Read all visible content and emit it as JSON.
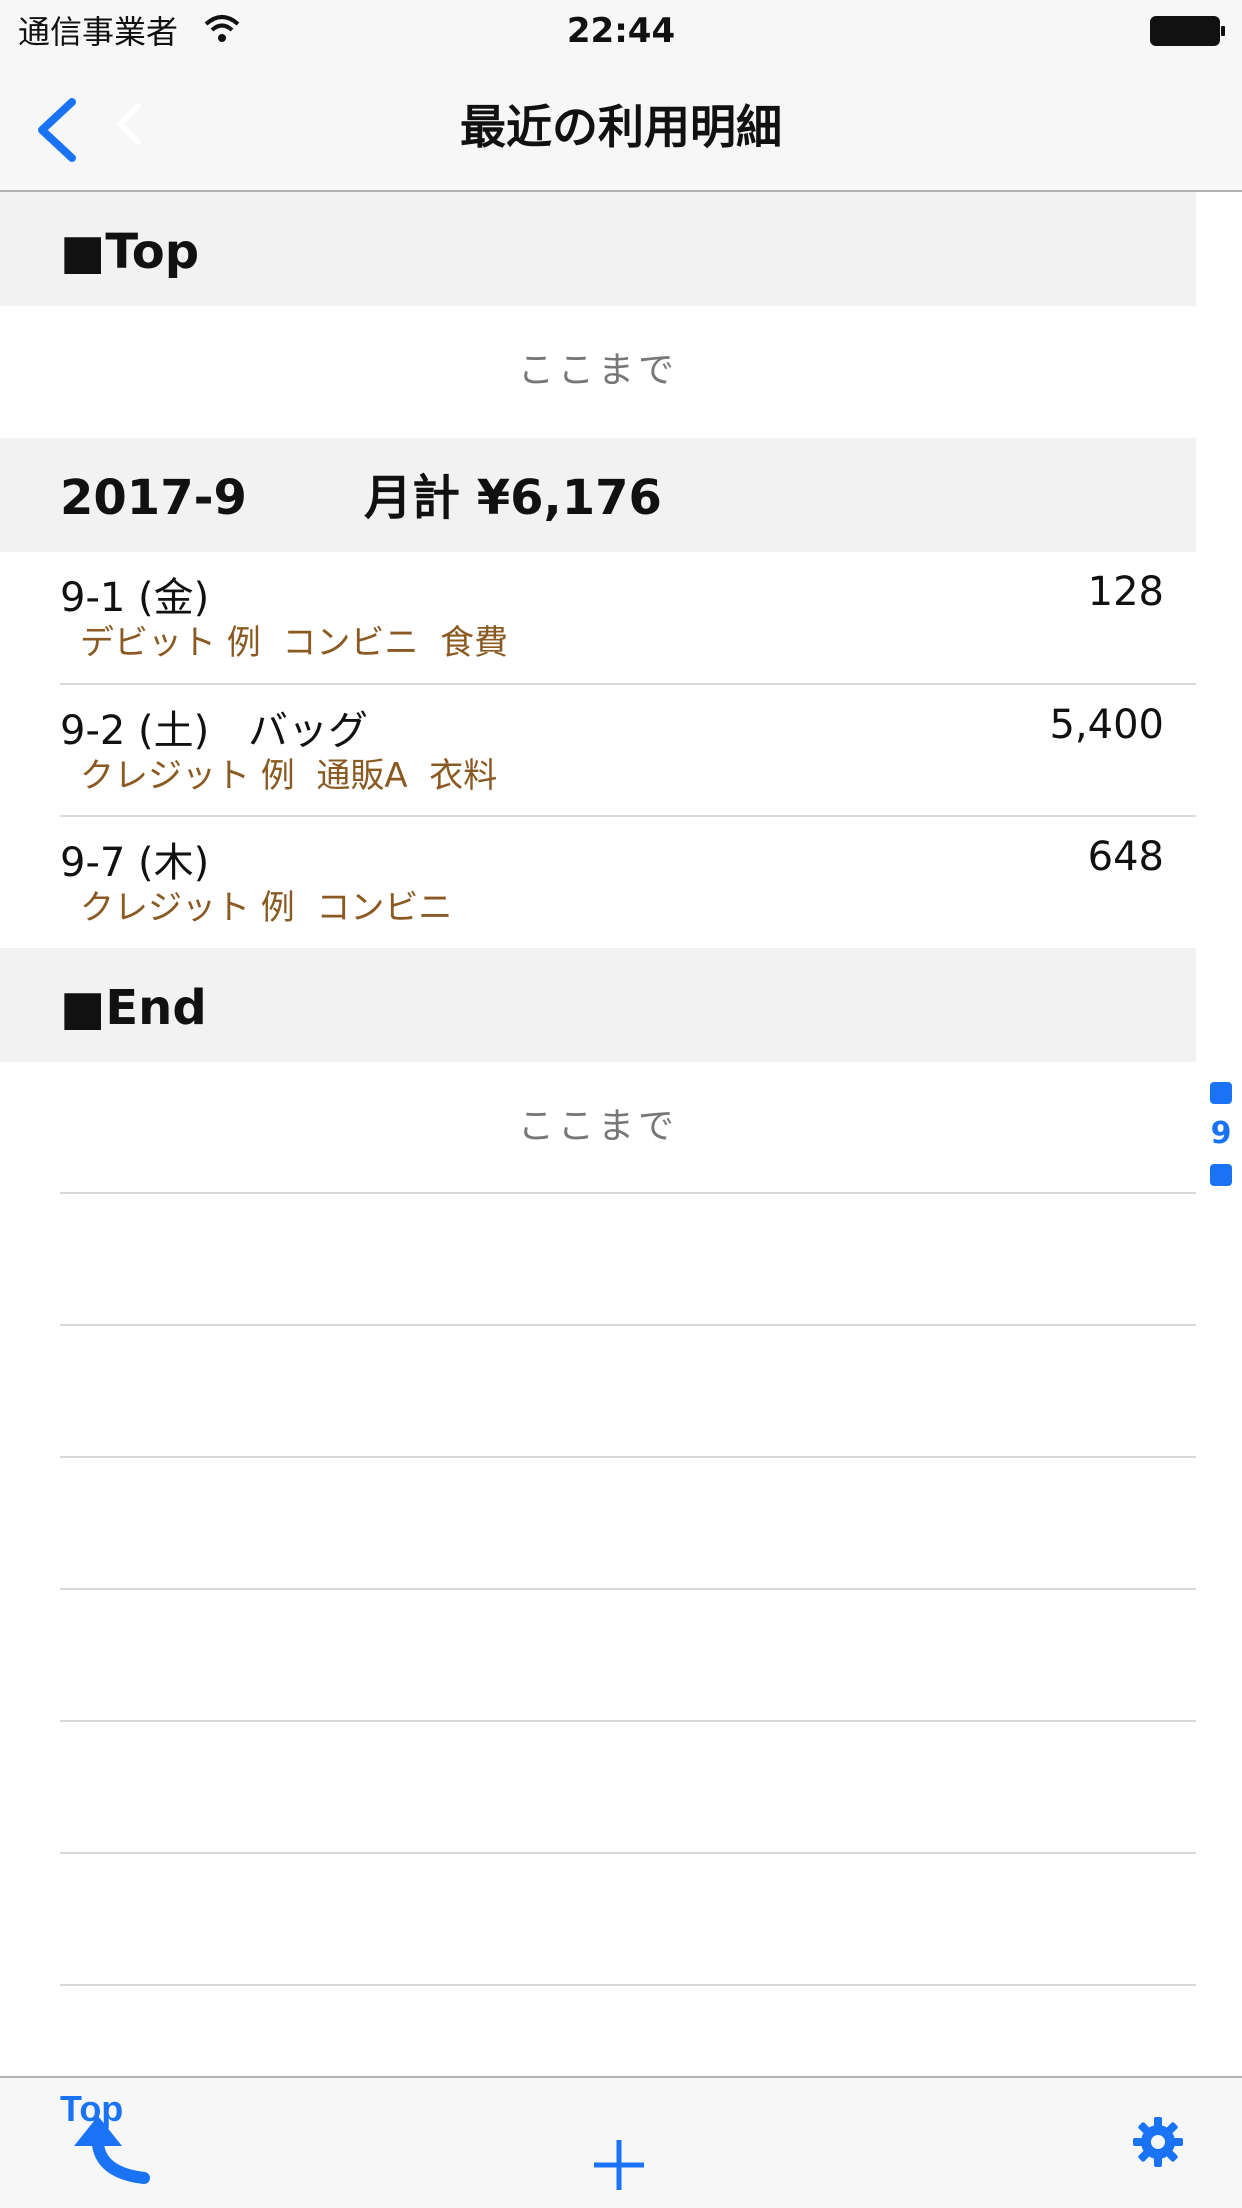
{
  "status_bar": {
    "carrier": "通信事業者",
    "time": "22:44"
  },
  "nav": {
    "title": "最近の利用明細"
  },
  "sections": {
    "top": {
      "label": "■Top",
      "end_text": "ここまで"
    },
    "month": {
      "label": "2017-9",
      "total": "月計 ¥6,176"
    },
    "end": {
      "label": "■End",
      "end_text": "ここまで"
    }
  },
  "entries": [
    {
      "date": "9-1 (金)",
      "memo": "",
      "amount": "128",
      "detail": "デビット 例  コンビニ  食費"
    },
    {
      "date": "9-2 (土)",
      "memo": "バッグ",
      "amount": "5,400",
      "detail": "クレジット 例  通販A  衣料"
    },
    {
      "date": "9-7 (木)",
      "memo": "",
      "amount": "648",
      "detail": "クレジット 例  コンビニ"
    }
  ],
  "index_bar": {
    "month": "9"
  },
  "toolbar": {
    "top_label": "Top"
  },
  "colors": {
    "accent": "#1a73f5",
    "detail_text": "#8a5a22",
    "section_bg": "#f2f2f2"
  }
}
